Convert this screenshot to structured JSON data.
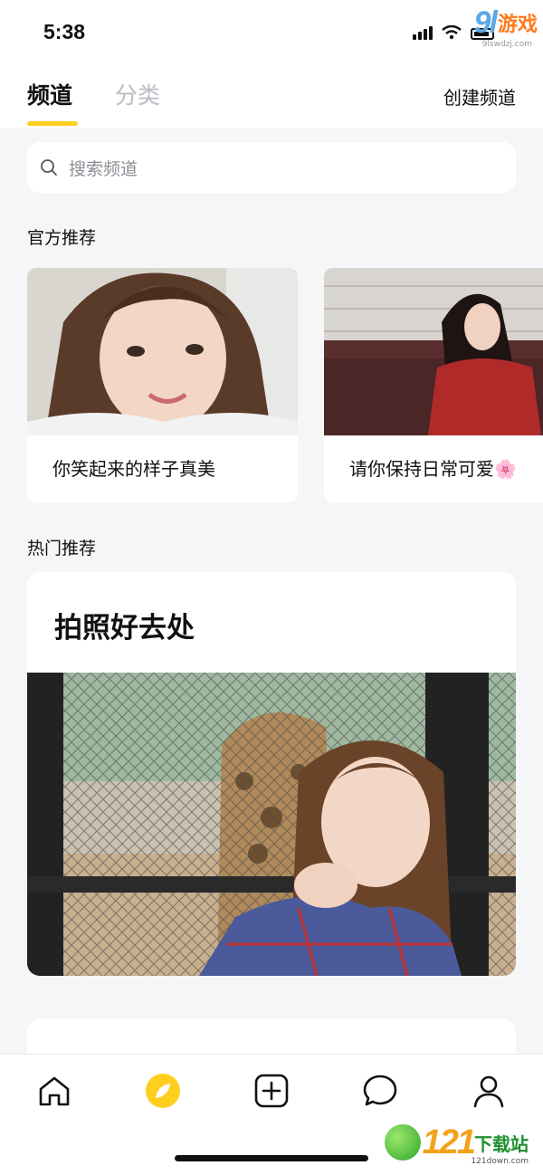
{
  "status_bar": {
    "time": "5:38"
  },
  "watermark_top": {
    "brand_number": "9l",
    "brand_text": "游戏",
    "domain": "9lswdzj.com"
  },
  "header": {
    "tabs": [
      {
        "label": "频道",
        "active": true
      },
      {
        "label": "分类",
        "active": false
      }
    ],
    "create_channel_label": "创建频道",
    "accent_color": "#ffcf1f"
  },
  "search": {
    "placeholder": "搜索频道",
    "icon": "search-icon"
  },
  "official": {
    "title": "官方推荐",
    "cards": [
      {
        "caption": "你笑起来的样子真美",
        "image": "photo-girl-selfie-portrait"
      },
      {
        "caption": "请你保持日常可爱🌸",
        "image": "photo-girl-red-dress-sofa"
      }
    ]
  },
  "hot": {
    "title": "热门推荐",
    "cards": [
      {
        "title": "拍照好去处",
        "image": "photo-girl-zoo-giraffe"
      }
    ]
  },
  "tab_bar": {
    "items": [
      {
        "name": "home",
        "icon": "home-icon"
      },
      {
        "name": "discover",
        "icon": "compass-leaf-icon",
        "active": true
      },
      {
        "name": "create",
        "icon": "plus-square-icon"
      },
      {
        "name": "messages",
        "icon": "chat-bubble-icon"
      },
      {
        "name": "profile",
        "icon": "user-icon"
      }
    ]
  },
  "watermark_bottom": {
    "brand_number": "121",
    "brand_text": "下载站",
    "domain": "121down.com"
  }
}
